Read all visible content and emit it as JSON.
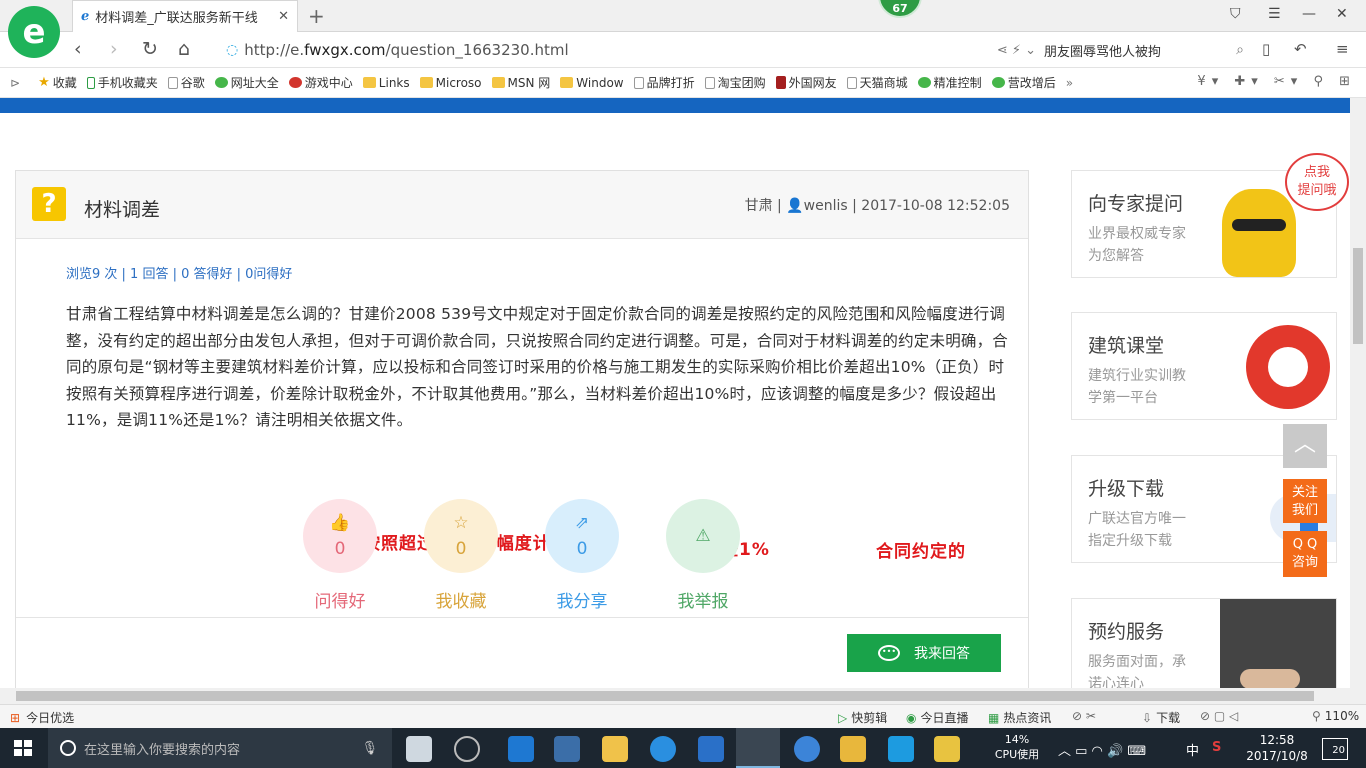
{
  "browser": {
    "tab_title": "材料调差_广联达服务新干线",
    "logo_letter": "e",
    "badge_count": "67",
    "url_prefix": "http://e.",
    "url_domain": "fwxgx.com",
    "url_path": "/question_1663230.html",
    "search_text": "朋友圈辱骂他人被拘",
    "bookmarks": [
      {
        "label": "收藏",
        "icon": "star"
      },
      {
        "label": "手机收藏夹",
        "icon": "phone"
      },
      {
        "label": "谷歌",
        "icon": "page"
      },
      {
        "label": "网址大全",
        "icon": "green"
      },
      {
        "label": "游戏中心",
        "icon": "red"
      },
      {
        "label": "Links",
        "icon": "folder"
      },
      {
        "label": "Microso",
        "icon": "folder"
      },
      {
        "label": "MSN 网",
        "icon": "folder"
      },
      {
        "label": "Window",
        "icon": "folder"
      },
      {
        "label": "品牌打折",
        "icon": "page"
      },
      {
        "label": "淘宝团购",
        "icon": "page"
      },
      {
        "label": "外国网友",
        "icon": "darkred"
      },
      {
        "label": "天猫商城",
        "icon": "page"
      },
      {
        "label": "精准控制",
        "icon": "green"
      },
      {
        "label": "营改增后",
        "icon": "green"
      }
    ]
  },
  "question": {
    "icon": "?",
    "title": "材料调差",
    "region": "甘肃",
    "author": "wenlis",
    "datetime": "2017-10-08 12:52:05",
    "stats": "浏览9 次 | 1 回答 | 0 答得好 | 0问得好",
    "body": "甘肃省工程结算中材料调差是怎么调的？甘建价2008 539号文中规定对于固定价款合同的调差是按照约定的风险范围和风险幅度进行调整，没有约定的超出部分由发包人承担，但对于可调价款合同，只说按照合同约定进行调整。可是，合同对于材料调差的约定未明确，合同的原句是“钢材等主要建筑材料差价计算，应以投标和合同签订时采用的价格与施工期发生的实际采购价相比价差超出10%（正负）时按照有关预算程序进行调差，价差除计取税金外，不计取其他费用。”那么，当材料差价超出10%时，应该调整的幅度是多少？假设超出11%，是调11%还是1%？请注明相关依据文件。",
    "annotations": [
      "按照超过10%的幅度计算",
      "调整1%",
      "合同约定的"
    ],
    "actions": [
      {
        "label": "问得好",
        "count": "0",
        "icon": "thumbs-up"
      },
      {
        "label": "我收藏",
        "count": "0",
        "icon": "star"
      },
      {
        "label": "我分享",
        "count": "0",
        "icon": "share"
      },
      {
        "label": "我举报",
        "count": "0",
        "icon": "warning"
      }
    ],
    "answer_button": "我来回答"
  },
  "sidebar": {
    "ask": {
      "title": "向专家提问",
      "line1": "业界最权威专家",
      "line2": "为您解答",
      "bubble1": "点我",
      "bubble2": "提问哦"
    },
    "course": {
      "title": "建筑课堂",
      "line1": "建筑行业实训教",
      "line2": "学第一平台"
    },
    "download": {
      "title": "升级下载",
      "line1": "广联达官方唯一",
      "line2": "指定升级下载"
    },
    "service": {
      "title": "预约服务",
      "line1": "服务面对面，承",
      "line2": "诺心连心"
    },
    "follow": [
      "关注",
      "我们"
    ],
    "qq": [
      "Q Q",
      "咨询"
    ]
  },
  "statusbar": {
    "left": "今日优选",
    "items": [
      "快剪辑",
      "今日直播",
      "热点资讯",
      "下载"
    ],
    "zoom": "110%"
  },
  "taskbar": {
    "search_placeholder": "在这里输入你要搜索的内容",
    "cpu_percent": "14%",
    "cpu_label": "CPU使用",
    "ime": "中",
    "time": "12:58",
    "date": "2017/10/8",
    "notifications": "20"
  }
}
